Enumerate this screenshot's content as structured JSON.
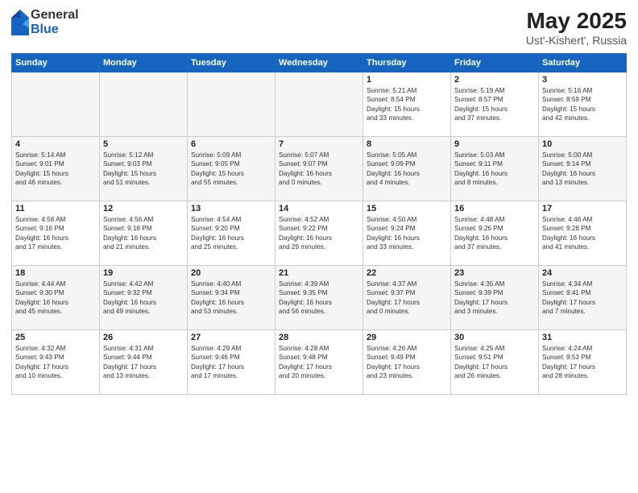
{
  "header": {
    "logo_general": "General",
    "logo_blue": "Blue",
    "title": "May 2025",
    "location": "Ust'-Kishert', Russia"
  },
  "weekdays": [
    "Sunday",
    "Monday",
    "Tuesday",
    "Wednesday",
    "Thursday",
    "Friday",
    "Saturday"
  ],
  "weeks": [
    [
      {
        "day": "",
        "info": ""
      },
      {
        "day": "",
        "info": ""
      },
      {
        "day": "",
        "info": ""
      },
      {
        "day": "",
        "info": ""
      },
      {
        "day": "1",
        "info": "Sunrise: 5:21 AM\nSunset: 8:54 PM\nDaylight: 15 hours\nand 33 minutes."
      },
      {
        "day": "2",
        "info": "Sunrise: 5:19 AM\nSunset: 8:57 PM\nDaylight: 15 hours\nand 37 minutes."
      },
      {
        "day": "3",
        "info": "Sunrise: 5:16 AM\nSunset: 8:59 PM\nDaylight: 15 hours\nand 42 minutes."
      }
    ],
    [
      {
        "day": "4",
        "info": "Sunrise: 5:14 AM\nSunset: 9:01 PM\nDaylight: 15 hours\nand 46 minutes."
      },
      {
        "day": "5",
        "info": "Sunrise: 5:12 AM\nSunset: 9:03 PM\nDaylight: 15 hours\nand 51 minutes."
      },
      {
        "day": "6",
        "info": "Sunrise: 5:09 AM\nSunset: 9:05 PM\nDaylight: 15 hours\nand 55 minutes."
      },
      {
        "day": "7",
        "info": "Sunrise: 5:07 AM\nSunset: 9:07 PM\nDaylight: 16 hours\nand 0 minutes."
      },
      {
        "day": "8",
        "info": "Sunrise: 5:05 AM\nSunset: 9:09 PM\nDaylight: 16 hours\nand 4 minutes."
      },
      {
        "day": "9",
        "info": "Sunrise: 5:03 AM\nSunset: 9:11 PM\nDaylight: 16 hours\nand 8 minutes."
      },
      {
        "day": "10",
        "info": "Sunrise: 5:00 AM\nSunset: 9:14 PM\nDaylight: 16 hours\nand 13 minutes."
      }
    ],
    [
      {
        "day": "11",
        "info": "Sunrise: 4:58 AM\nSunset: 9:16 PM\nDaylight: 16 hours\nand 17 minutes."
      },
      {
        "day": "12",
        "info": "Sunrise: 4:56 AM\nSunset: 9:18 PM\nDaylight: 16 hours\nand 21 minutes."
      },
      {
        "day": "13",
        "info": "Sunrise: 4:54 AM\nSunset: 9:20 PM\nDaylight: 16 hours\nand 25 minutes."
      },
      {
        "day": "14",
        "info": "Sunrise: 4:52 AM\nSunset: 9:22 PM\nDaylight: 16 hours\nand 29 minutes."
      },
      {
        "day": "15",
        "info": "Sunrise: 4:50 AM\nSunset: 9:24 PM\nDaylight: 16 hours\nand 33 minutes."
      },
      {
        "day": "16",
        "info": "Sunrise: 4:48 AM\nSunset: 9:26 PM\nDaylight: 16 hours\nand 37 minutes."
      },
      {
        "day": "17",
        "info": "Sunrise: 4:46 AM\nSunset: 9:28 PM\nDaylight: 16 hours\nand 41 minutes."
      }
    ],
    [
      {
        "day": "18",
        "info": "Sunrise: 4:44 AM\nSunset: 9:30 PM\nDaylight: 16 hours\nand 45 minutes."
      },
      {
        "day": "19",
        "info": "Sunrise: 4:42 AM\nSunset: 9:32 PM\nDaylight: 16 hours\nand 49 minutes."
      },
      {
        "day": "20",
        "info": "Sunrise: 4:40 AM\nSunset: 9:34 PM\nDaylight: 16 hours\nand 53 minutes."
      },
      {
        "day": "21",
        "info": "Sunrise: 4:39 AM\nSunset: 9:35 PM\nDaylight: 16 hours\nand 56 minutes."
      },
      {
        "day": "22",
        "info": "Sunrise: 4:37 AM\nSunset: 9:37 PM\nDaylight: 17 hours\nand 0 minutes."
      },
      {
        "day": "23",
        "info": "Sunrise: 4:35 AM\nSunset: 9:39 PM\nDaylight: 17 hours\nand 3 minutes."
      },
      {
        "day": "24",
        "info": "Sunrise: 4:34 AM\nSunset: 9:41 PM\nDaylight: 17 hours\nand 7 minutes."
      }
    ],
    [
      {
        "day": "25",
        "info": "Sunrise: 4:32 AM\nSunset: 9:43 PM\nDaylight: 17 hours\nand 10 minutes."
      },
      {
        "day": "26",
        "info": "Sunrise: 4:31 AM\nSunset: 9:44 PM\nDaylight: 17 hours\nand 13 minutes."
      },
      {
        "day": "27",
        "info": "Sunrise: 4:29 AM\nSunset: 9:46 PM\nDaylight: 17 hours\nand 17 minutes."
      },
      {
        "day": "28",
        "info": "Sunrise: 4:28 AM\nSunset: 9:48 PM\nDaylight: 17 hours\nand 20 minutes."
      },
      {
        "day": "29",
        "info": "Sunrise: 4:26 AM\nSunset: 9:49 PM\nDaylight: 17 hours\nand 23 minutes."
      },
      {
        "day": "30",
        "info": "Sunrise: 4:25 AM\nSunset: 9:51 PM\nDaylight: 17 hours\nand 26 minutes."
      },
      {
        "day": "31",
        "info": "Sunrise: 4:24 AM\nSunset: 9:53 PM\nDaylight: 17 hours\nand 28 minutes."
      }
    ]
  ]
}
